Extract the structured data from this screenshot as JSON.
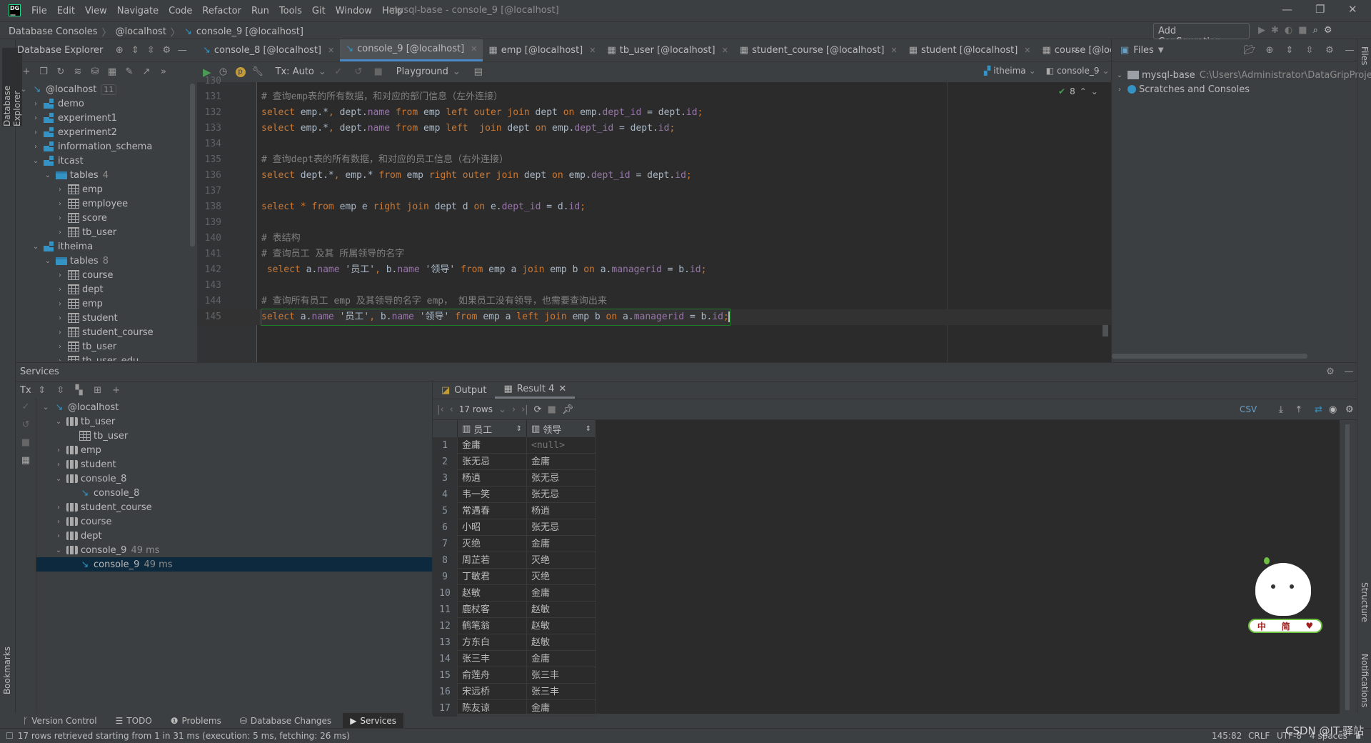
{
  "app": {
    "logo": "DG",
    "menu": [
      "File",
      "Edit",
      "View",
      "Navigate",
      "Code",
      "Refactor",
      "Run",
      "Tools",
      "Git",
      "Window",
      "Help"
    ],
    "window_title": "mysql-base - console_9 [@localhost]"
  },
  "breadcrumb": [
    "Database Consoles",
    "@localhost",
    "console_9 [@localhost]"
  ],
  "add_configuration": "Add Configuration...",
  "left_strip": {
    "database_explorer": "Database Explorer",
    "bookmarks": "Bookmarks"
  },
  "right_strip": {
    "files": "Files",
    "structure": "Structure",
    "notifications": "Notifications"
  },
  "db_explorer": {
    "title": "Database Explorer",
    "tree": [
      {
        "d": 0,
        "a": "open",
        "icon": "mysql",
        "label": "@localhost",
        "badge": "11"
      },
      {
        "d": 1,
        "a": "closed",
        "icon": "schema",
        "label": "demo"
      },
      {
        "d": 1,
        "a": "closed",
        "icon": "schema",
        "label": "experiment1"
      },
      {
        "d": 1,
        "a": "closed",
        "icon": "schema",
        "label": "experiment2"
      },
      {
        "d": 1,
        "a": "closed",
        "icon": "schema",
        "label": "information_schema"
      },
      {
        "d": 1,
        "a": "open",
        "icon": "schema",
        "label": "itcast"
      },
      {
        "d": 2,
        "a": "open",
        "icon": "folder",
        "label": "tables",
        "count": "4"
      },
      {
        "d": 3,
        "a": "closed",
        "icon": "table",
        "label": "emp"
      },
      {
        "d": 3,
        "a": "closed",
        "icon": "table",
        "label": "employee"
      },
      {
        "d": 3,
        "a": "closed",
        "icon": "table",
        "label": "score"
      },
      {
        "d": 3,
        "a": "closed",
        "icon": "table",
        "label": "tb_user"
      },
      {
        "d": 1,
        "a": "open",
        "icon": "schema",
        "label": "itheima"
      },
      {
        "d": 2,
        "a": "open",
        "icon": "folder",
        "label": "tables",
        "count": "8"
      },
      {
        "d": 3,
        "a": "closed",
        "icon": "table",
        "label": "course"
      },
      {
        "d": 3,
        "a": "closed",
        "icon": "table",
        "label": "dept"
      },
      {
        "d": 3,
        "a": "closed",
        "icon": "table",
        "label": "emp"
      },
      {
        "d": 3,
        "a": "closed",
        "icon": "table",
        "label": "student"
      },
      {
        "d": 3,
        "a": "closed",
        "icon": "table",
        "label": "student_course"
      },
      {
        "d": 3,
        "a": "closed",
        "icon": "table",
        "label": "tb_user"
      },
      {
        "d": 3,
        "a": "closed",
        "icon": "table",
        "label": "tb_user_edu"
      }
    ]
  },
  "editor_tabs": [
    {
      "label": "console_8 [@localhost]",
      "icon": "console",
      "active": false
    },
    {
      "label": "console_9 [@localhost]",
      "icon": "console",
      "active": true
    },
    {
      "label": "emp [@localhost]",
      "icon": "table",
      "active": false
    },
    {
      "label": "tb_user [@localhost]",
      "icon": "table",
      "active": false
    },
    {
      "label": "student_course [@localhost]",
      "icon": "table",
      "active": false
    },
    {
      "label": "student [@localhost]",
      "icon": "table",
      "active": false
    },
    {
      "label": "course [@localhost]",
      "icon": "table",
      "active": false
    }
  ],
  "editor_toolbar": {
    "tx": "Tx: Auto",
    "playground": "Playground",
    "schema": "itheima",
    "session": "console_9"
  },
  "inspection_count": "8",
  "code": [
    {
      "n": "130",
      "t": []
    },
    {
      "n": "131",
      "t": [
        [
          "c",
          "# 查询emp表的所有数据，和对应的部门信息（左外连接）"
        ]
      ]
    },
    {
      "n": "132",
      "t": [
        [
          "k",
          "select"
        ],
        [
          "i",
          " emp.*"
        ],
        [
          "p",
          ","
        ],
        [
          "i",
          " dept."
        ],
        [
          "f",
          "name"
        ],
        [
          "k",
          " from"
        ],
        [
          "i",
          " emp "
        ],
        [
          "k",
          "left outer join"
        ],
        [
          "i",
          " dept "
        ],
        [
          "k",
          "on"
        ],
        [
          "i",
          " emp."
        ],
        [
          "f",
          "dept_id"
        ],
        [
          "i",
          " = dept."
        ],
        [
          "f",
          "id"
        ],
        [
          "p",
          ";"
        ]
      ]
    },
    {
      "n": "133",
      "t": [
        [
          "k",
          "select"
        ],
        [
          "i",
          " emp.*"
        ],
        [
          "p",
          ","
        ],
        [
          "i",
          " dept."
        ],
        [
          "f",
          "name"
        ],
        [
          "k",
          " from"
        ],
        [
          "i",
          " emp "
        ],
        [
          "k",
          "left  join"
        ],
        [
          "i",
          " dept "
        ],
        [
          "k",
          "on"
        ],
        [
          "i",
          " emp."
        ],
        [
          "f",
          "dept_id"
        ],
        [
          "i",
          " = dept."
        ],
        [
          "f",
          "id"
        ],
        [
          "p",
          ";"
        ]
      ]
    },
    {
      "n": "134",
      "t": []
    },
    {
      "n": "135",
      "t": [
        [
          "c",
          "# 查询dept表的所有数据，和对应的员工信息（右外连接）"
        ]
      ]
    },
    {
      "n": "136",
      "t": [
        [
          "k",
          "select"
        ],
        [
          "i",
          " dept.*"
        ],
        [
          "p",
          ","
        ],
        [
          "i",
          " emp.* "
        ],
        [
          "k",
          "from"
        ],
        [
          "i",
          " emp "
        ],
        [
          "k",
          "right outer join"
        ],
        [
          "i",
          " dept "
        ],
        [
          "k",
          "on"
        ],
        [
          "i",
          " emp."
        ],
        [
          "f",
          "dept_id"
        ],
        [
          "i",
          " = dept."
        ],
        [
          "f",
          "id"
        ],
        [
          "p",
          ";"
        ]
      ]
    },
    {
      "n": "137",
      "t": []
    },
    {
      "n": "138",
      "t": [
        [
          "k",
          "select"
        ],
        [
          "p",
          " *"
        ],
        [
          "k",
          " from"
        ],
        [
          "i",
          " emp e "
        ],
        [
          "k",
          "right join"
        ],
        [
          "i",
          " dept d "
        ],
        [
          "k",
          "on"
        ],
        [
          "i",
          " e."
        ],
        [
          "f",
          "dept_id"
        ],
        [
          "i",
          " = d."
        ],
        [
          "f",
          "id"
        ],
        [
          "p",
          ";"
        ]
      ]
    },
    {
      "n": "139",
      "t": []
    },
    {
      "n": "140",
      "t": [
        [
          "c",
          "# 表结构"
        ]
      ]
    },
    {
      "n": "141",
      "t": [
        [
          "c",
          "# 查询员工 及其 所属领导的名字"
        ]
      ]
    },
    {
      "n": "142",
      "t": [
        [
          "k",
          " select"
        ],
        [
          "i",
          " a."
        ],
        [
          "f",
          "name"
        ],
        [
          "s",
          " '员工'"
        ],
        [
          "p",
          ","
        ],
        [
          "i",
          " b."
        ],
        [
          "f",
          "name"
        ],
        [
          "s",
          " '领导'"
        ],
        [
          "k",
          " from"
        ],
        [
          "i",
          " emp a "
        ],
        [
          "k",
          "join"
        ],
        [
          "i",
          " emp b "
        ],
        [
          "k",
          "on"
        ],
        [
          "i",
          " a."
        ],
        [
          "f",
          "managerid"
        ],
        [
          "i",
          " = b."
        ],
        [
          "f",
          "id"
        ],
        [
          "p",
          ";"
        ]
      ]
    },
    {
      "n": "143",
      "t": []
    },
    {
      "n": "144",
      "t": [
        [
          "c",
          "# 查询所有员工 emp 及其领导的名字 emp， 如果员工没有领导，也需要查询出来"
        ]
      ]
    },
    {
      "n": "145",
      "t": [
        [
          "k",
          "select"
        ],
        [
          "i",
          " a."
        ],
        [
          "f",
          "name"
        ],
        [
          "s",
          " '员工'"
        ],
        [
          "p",
          ","
        ],
        [
          "i",
          " b."
        ],
        [
          "f",
          "name"
        ],
        [
          "s",
          " '领导'"
        ],
        [
          "k",
          " from"
        ],
        [
          "i",
          " emp a "
        ],
        [
          "k",
          "left join"
        ],
        [
          "i",
          " emp b "
        ],
        [
          "k",
          "on"
        ],
        [
          "i",
          " a."
        ],
        [
          "f",
          "managerid"
        ],
        [
          "i",
          " = b."
        ],
        [
          "f",
          "id"
        ],
        [
          "p",
          ";"
        ]
      ],
      "current": true
    }
  ],
  "files_panel": {
    "title": "Files",
    "items": [
      {
        "label": "mysql-base",
        "path": "C:\\Users\\Administrator\\DataGripProjec",
        "a": "open"
      },
      {
        "label": "Scratches and Consoles",
        "a": "closed"
      }
    ]
  },
  "services": {
    "title": "Services",
    "tx": "Tx",
    "tree": [
      {
        "d": 0,
        "a": "open",
        "icon": "mysql",
        "label": "@localhost"
      },
      {
        "d": 1,
        "a": "open",
        "icon": "svc",
        "label": "tb_user"
      },
      {
        "d": 2,
        "a": "none",
        "icon": "table",
        "label": "tb_user"
      },
      {
        "d": 1,
        "a": "closed",
        "icon": "svc",
        "label": "emp"
      },
      {
        "d": 1,
        "a": "closed",
        "icon": "svc",
        "label": "student"
      },
      {
        "d": 1,
        "a": "open",
        "icon": "svc",
        "label": "console_8"
      },
      {
        "d": 2,
        "a": "none",
        "icon": "mysql",
        "label": "console_8"
      },
      {
        "d": 1,
        "a": "closed",
        "icon": "svc",
        "label": "student_course"
      },
      {
        "d": 1,
        "a": "closed",
        "icon": "svc",
        "label": "course"
      },
      {
        "d": 1,
        "a": "closed",
        "icon": "svc",
        "label": "dept"
      },
      {
        "d": 1,
        "a": "open",
        "icon": "svc",
        "label": "console_9",
        "time": "49 ms"
      },
      {
        "d": 2,
        "a": "none",
        "icon": "mysql",
        "label": "console_9",
        "time": "49 ms",
        "selected": true
      }
    ]
  },
  "result": {
    "tabs": [
      {
        "label": "Output",
        "active": false
      },
      {
        "label": "Result 4",
        "active": true
      }
    ],
    "rows_selector": "17 rows",
    "export_format": "CSV",
    "columns": [
      "员工",
      "领导"
    ],
    "null_text": "<null>",
    "rows": [
      [
        "金庸",
        null
      ],
      [
        "张无忌",
        "金庸"
      ],
      [
        "杨逍",
        "张无忌"
      ],
      [
        "韦一笑",
        "张无忌"
      ],
      [
        "常遇春",
        "杨逍"
      ],
      [
        "小昭",
        "张无忌"
      ],
      [
        "灭绝",
        "金庸"
      ],
      [
        "周芷若",
        "灭绝"
      ],
      [
        "丁敏君",
        "灭绝"
      ],
      [
        "赵敏",
        "金庸"
      ],
      [
        "鹿杖客",
        "赵敏"
      ],
      [
        "鹤笔翁",
        "赵敏"
      ],
      [
        "方东白",
        "赵敏"
      ],
      [
        "张三丰",
        "金庸"
      ],
      [
        "俞莲舟",
        "张三丰"
      ],
      [
        "宋远桥",
        "张三丰"
      ],
      [
        "陈友谅",
        "金庸"
      ]
    ]
  },
  "bottom_tabs": [
    {
      "label": "Version Control",
      "icon": "vcs"
    },
    {
      "label": "TODO",
      "icon": "list"
    },
    {
      "label": "Problems",
      "icon": "info"
    },
    {
      "label": "Database Changes",
      "icon": "db"
    },
    {
      "label": "Services",
      "icon": "play",
      "active": true
    }
  ],
  "status": {
    "message": "17 rows retrieved starting from 1 in 31 ms (execution: 5 ms, fetching: 26 ms)",
    "position": "145:82",
    "line_ending": "CRLF",
    "encoding": "UTF-8",
    "indent": "4 spaces"
  },
  "ime": {
    "chars": [
      "中",
      "简"
    ]
  },
  "watermark": "CSDN @IT-驿站",
  "colors": {
    "keyword": "#cc7832",
    "identifier": "#a9b7c6",
    "field": "#9876aa",
    "comment": "#808080",
    "accent": "#4a88c7",
    "selection": "#0d293e"
  }
}
